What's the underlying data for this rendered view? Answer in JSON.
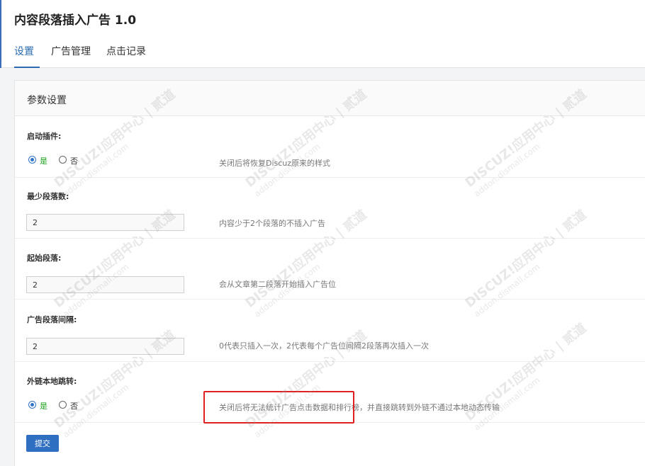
{
  "app": {
    "title": "内容段落插入广告 1.0"
  },
  "tabs": [
    {
      "label": "设置",
      "active": true
    },
    {
      "label": "广告管理",
      "active": false
    },
    {
      "label": "点击记录",
      "active": false
    }
  ],
  "panel": {
    "title": "参数设置"
  },
  "settings": {
    "enable_plugin": {
      "label": "启动插件:",
      "option_yes": "是",
      "option_no": "否",
      "selected": "是",
      "hint": "关闭后将恢复Discuz原来的样式"
    },
    "min_paragraphs": {
      "label": "最少段落数:",
      "value": "2",
      "hint": "内容少于2个段落的不插入广告"
    },
    "start_paragraph": {
      "label": "起始段落:",
      "value": "2",
      "hint": "会从文章第二段落开始插入广告位"
    },
    "ad_interval": {
      "label": "广告段落间隔:",
      "value": "2",
      "hint": "0代表只插入一次，2代表每个广告位间隔2段落再次插入一次"
    },
    "external_redirect": {
      "label": "外链本地跳转:",
      "option_yes": "是",
      "option_no": "否",
      "selected": "是",
      "hint": "关闭后将无法统计广告点击数据和排行榜，并直接跳转到外链不通过本地动态传输"
    }
  },
  "submit_label": "提交",
  "watermark": {
    "brand": "DISCUZ!应用中心 | 贰道",
    "url": "addon.dismall.com"
  },
  "colors": {
    "accent": "#2f6fc2",
    "yes_green": "#1aa11a",
    "highlight_red": "#e02020"
  }
}
